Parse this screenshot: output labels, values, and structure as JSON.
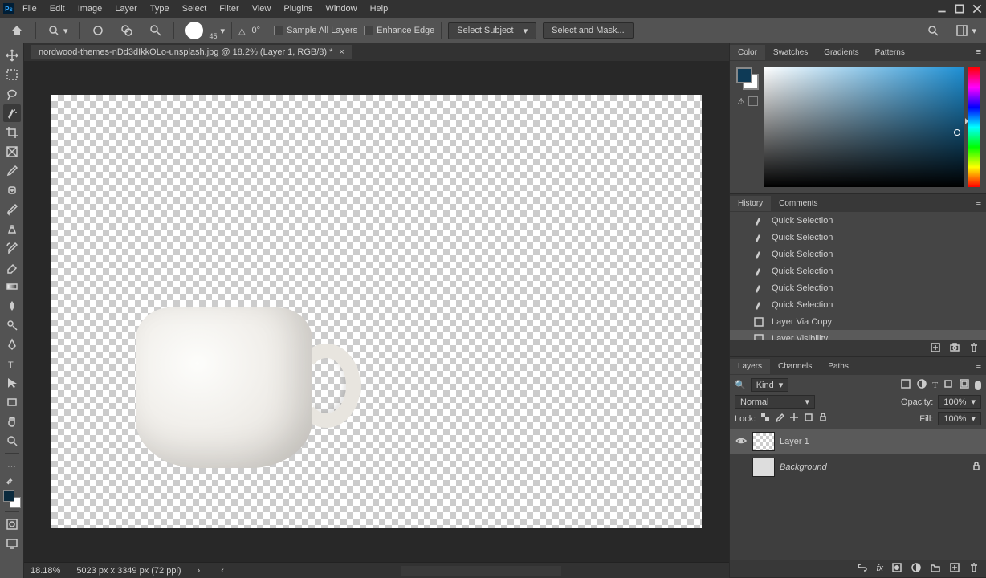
{
  "menubar": [
    "File",
    "Edit",
    "Image",
    "Layer",
    "Type",
    "Select",
    "Filter",
    "View",
    "Plugins",
    "Window",
    "Help"
  ],
  "options": {
    "brush_size": "45",
    "angle": "0°",
    "sample_all": "Sample All Layers",
    "enhance": "Enhance Edge",
    "select_subject": "Select Subject",
    "select_and_mask": "Select and Mask..."
  },
  "document": {
    "tab_title": "nordwood-themes-nDd3dIkkOLo-unsplash.jpg @ 18.2% (Layer 1, RGB/8) *",
    "artboard_w": 810,
    "artboard_h": 540
  },
  "status": {
    "zoom": "18.18%",
    "dims": "5023 px x 3349 px (72 ppi)"
  },
  "panels": {
    "color_tabs": [
      "Color",
      "Swatches",
      "Gradients",
      "Patterns"
    ],
    "history_tabs": [
      "History",
      "Comments"
    ],
    "layers_tabs": [
      "Layers",
      "Channels",
      "Paths"
    ]
  },
  "history": [
    {
      "label": "Quick Selection",
      "type": "qs"
    },
    {
      "label": "Quick Selection",
      "type": "qs"
    },
    {
      "label": "Quick Selection",
      "type": "qs"
    },
    {
      "label": "Quick Selection",
      "type": "qs"
    },
    {
      "label": "Quick Selection",
      "type": "qs"
    },
    {
      "label": "Quick Selection",
      "type": "qs"
    },
    {
      "label": "Layer Via Copy",
      "type": "layer"
    },
    {
      "label": "Layer Visibility",
      "type": "layer",
      "active": true
    }
  ],
  "layers_opts": {
    "filter_label": "Kind",
    "blend": "Normal",
    "opacity_label": "Opacity:",
    "opacity": "100%",
    "fill_label": "Fill:",
    "fill": "100%",
    "lock_label": "Lock:"
  },
  "layers": [
    {
      "name": "Layer 1",
      "visible": true,
      "active": true,
      "bg": false
    },
    {
      "name": "Background",
      "visible": false,
      "active": false,
      "bg": true,
      "locked": true
    }
  ]
}
